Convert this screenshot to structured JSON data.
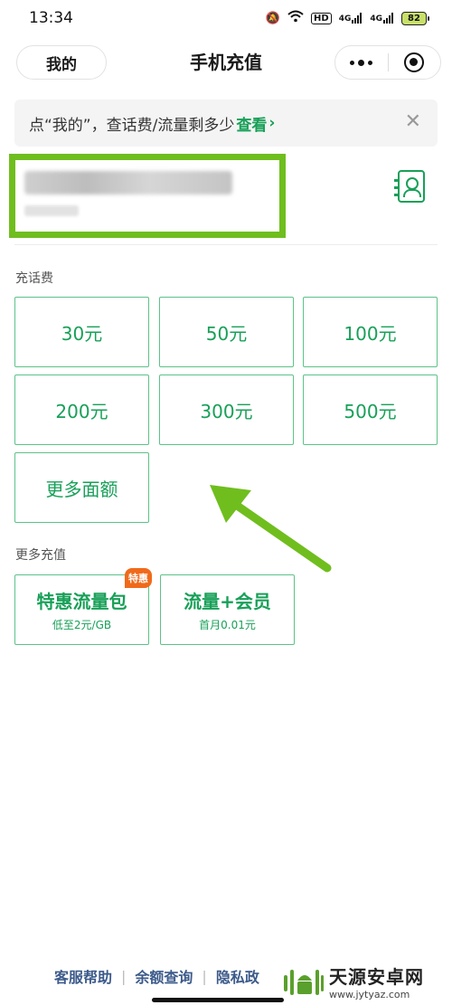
{
  "status_bar": {
    "time": "13:34",
    "network_1": "4G",
    "network_2": "4G",
    "hd": "HD",
    "battery": "82"
  },
  "nav": {
    "me_label": "我的",
    "title": "手机充值"
  },
  "tip": {
    "text": "点“我的”，查话费/流量剩多少",
    "link": "查看",
    "chevron": "›",
    "close": "✕"
  },
  "recharge_section": {
    "label": "充话费",
    "amounts": [
      "30元",
      "50元",
      "100元",
      "200元",
      "300元",
      "500元"
    ],
    "more_label": "更多面额"
  },
  "more_section": {
    "label": "更多充值",
    "items": [
      {
        "title": "特惠流量包",
        "subtitle": "低至2元/GB",
        "badge": "特惠"
      },
      {
        "title": "流量+会员",
        "subtitle": "首月0.01元"
      }
    ]
  },
  "footer": {
    "links": [
      "客服帮助",
      "余额查询",
      "隐私政"
    ]
  },
  "watermark": {
    "title": "天源安卓网",
    "url": "www.jytyaz.com"
  },
  "colors": {
    "accent": "#18a058",
    "highlight_box": "#6fbe1e",
    "arrow": "#6fbe1e",
    "badge": "#f06a1b"
  }
}
